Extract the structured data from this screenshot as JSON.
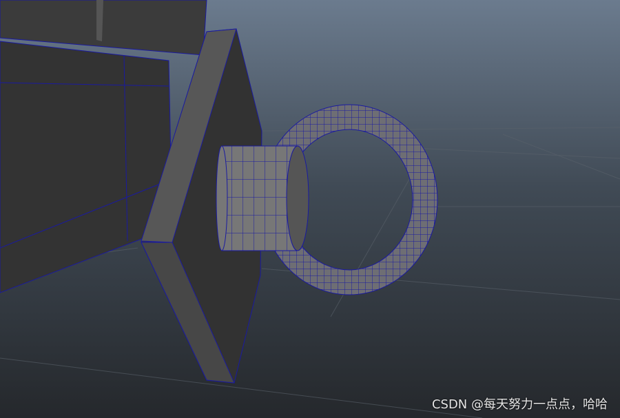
{
  "viewport": {
    "background_top": "#6b7b8e",
    "background_bottom": "#25282c",
    "wire_color": "#1a1aa0"
  },
  "watermark": "CSDN @每天努力一点点，哈哈"
}
